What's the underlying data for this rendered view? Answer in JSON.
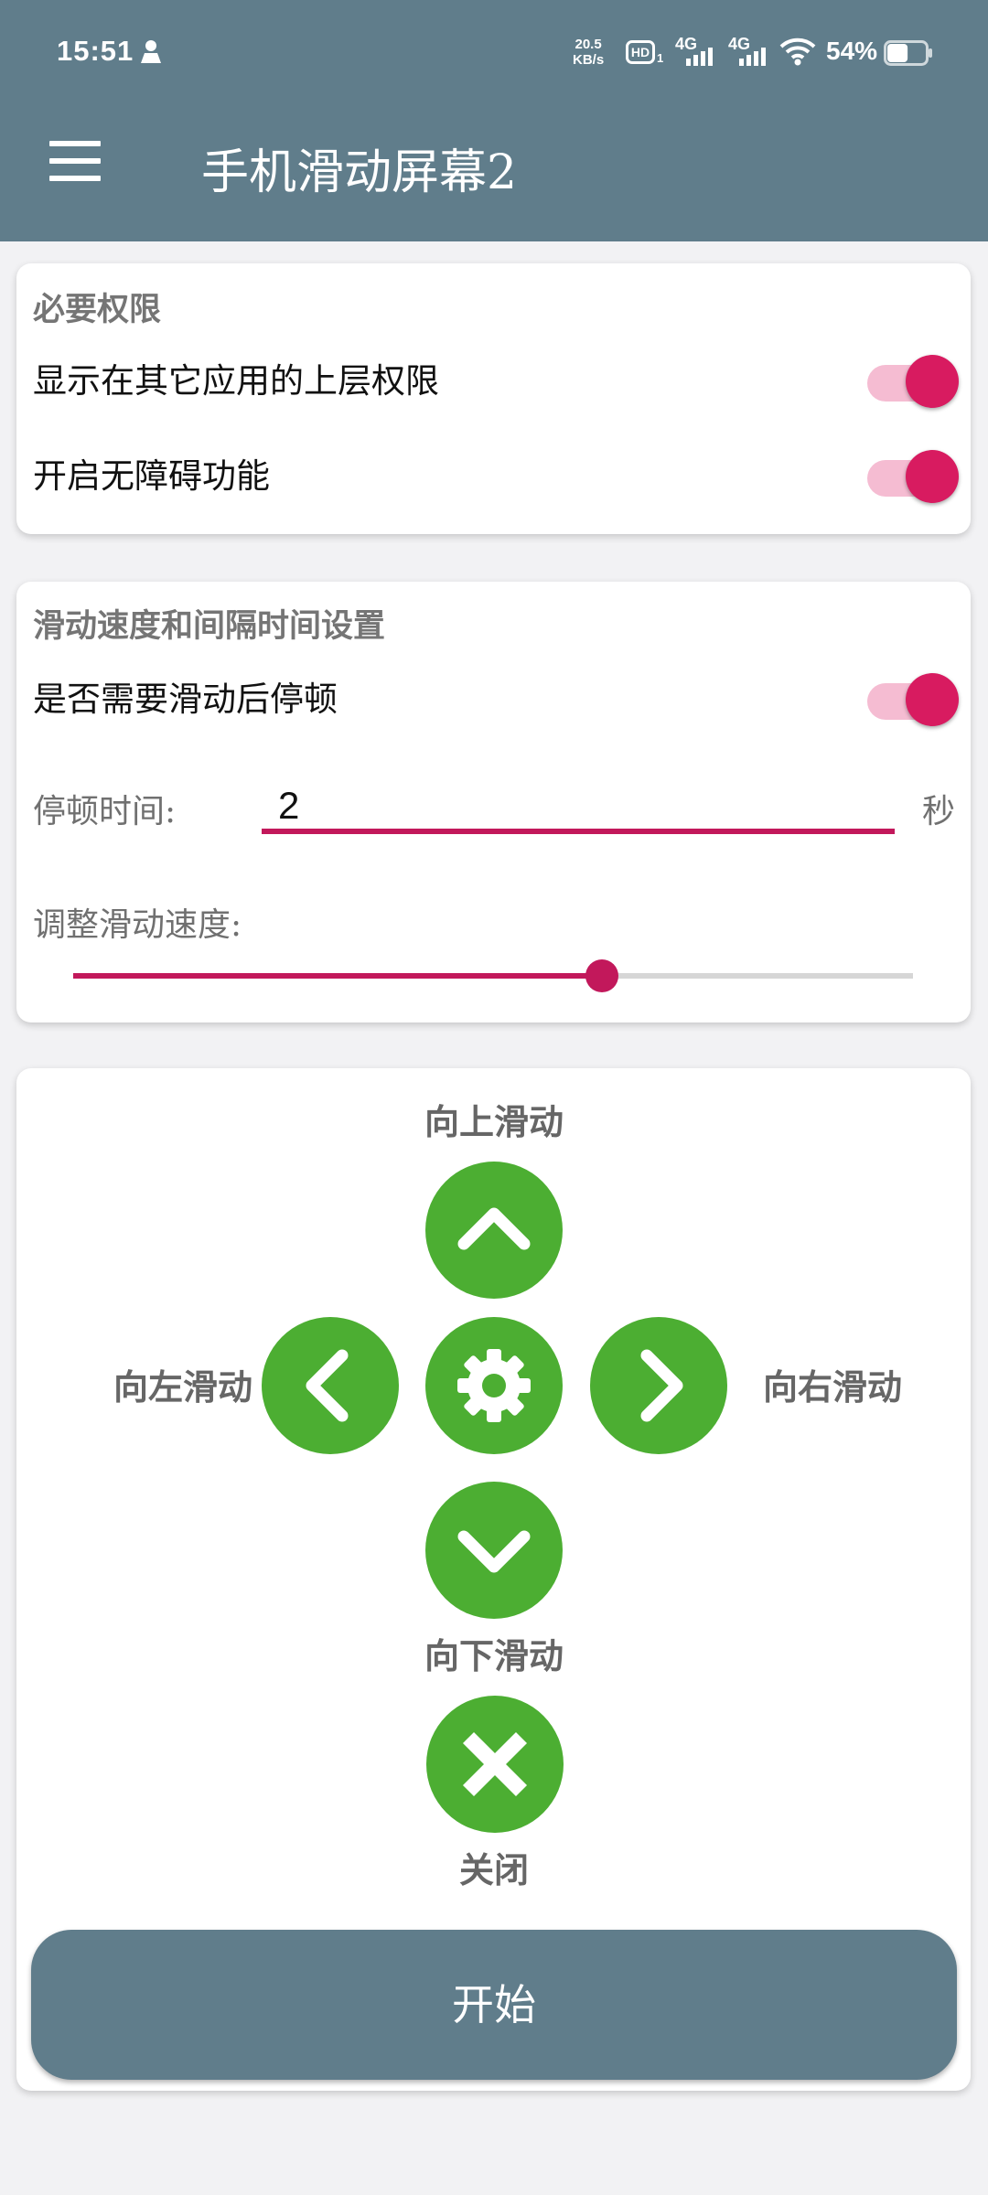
{
  "status_bar": {
    "time": "15:51",
    "net_speed_value": "20.5",
    "net_speed_unit": "KB/s",
    "hd_label": "HD",
    "hd_sub": "1",
    "signal1_label": "4G",
    "signal2_label": "4G",
    "battery_percent": "54%",
    "battery_level": 0.54
  },
  "app_bar": {
    "title": "手机滑动屏幕2",
    "menu_icon": "hamburger-menu-icon"
  },
  "permissions": {
    "title": "必要权限",
    "overlay_label": "显示在其它应用的上层权限",
    "overlay_enabled": true,
    "accessibility_label": "开启无障碍功能",
    "accessibility_enabled": true
  },
  "speed_settings": {
    "title": "滑动速度和间隔时间设置",
    "pause_label": "是否需要滑动后停顿",
    "pause_enabled": true,
    "pause_time_label": "停顿时间:",
    "pause_time_value": "2",
    "pause_time_unit": "秒",
    "speed_label": "调整滑动速度:",
    "speed_fraction": 0.63
  },
  "controls": {
    "up_label": "向上滑动",
    "left_label": "向左滑动",
    "right_label": "向右滑动",
    "down_label": "向下滑动",
    "close_label": "关闭",
    "start_label": "开始",
    "button_color": "#4cae32",
    "accent_color": "#d81b60",
    "primary_color": "#607d8b"
  }
}
